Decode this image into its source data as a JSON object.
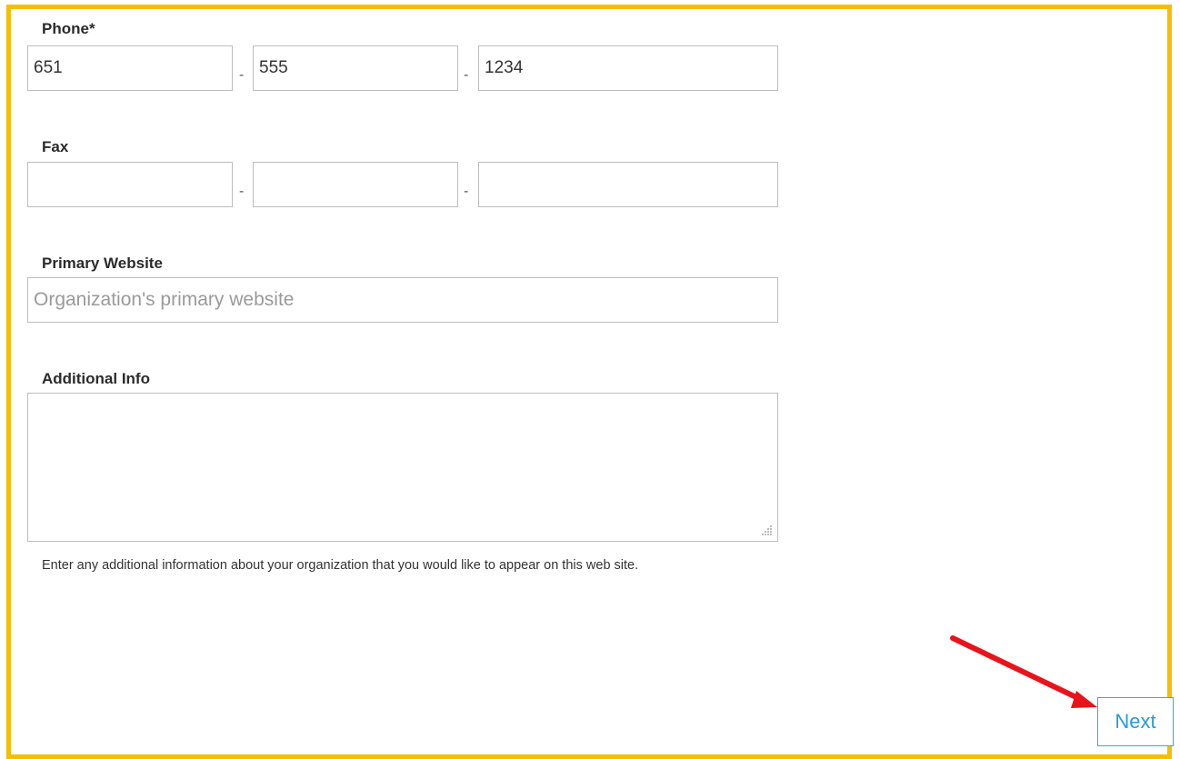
{
  "phone": {
    "label": "Phone*",
    "area": "651",
    "prefix": "555",
    "line": "1234",
    "separator": "-"
  },
  "fax": {
    "label": "Fax",
    "area": "",
    "prefix": "",
    "line": "",
    "separator": "-"
  },
  "website": {
    "label": "Primary Website",
    "placeholder": "Organization's primary website",
    "value": ""
  },
  "additional_info": {
    "label": "Additional Info",
    "value": "",
    "help_text": "Enter any additional information about your organization that you would like to appear on this web site."
  },
  "next_button": {
    "label": "Next"
  },
  "colors": {
    "frame_border": "#f5be00",
    "accent": "#2a9ad6",
    "annotation_arrow": "#e8141c"
  }
}
